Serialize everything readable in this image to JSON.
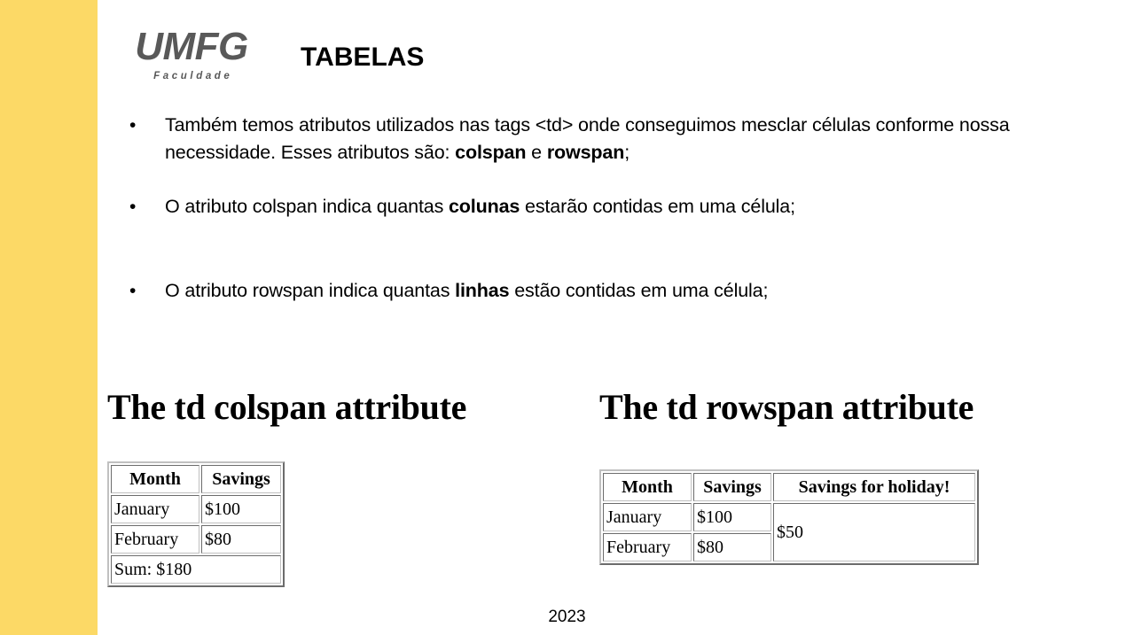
{
  "accent": {
    "color": "#fcd966"
  },
  "header": {
    "logo_word": "UMFG",
    "logo_sub": "Faculdade",
    "title": "TABELAS"
  },
  "bullets": [
    {
      "marker": "•",
      "parts": [
        {
          "text": "Também temos atributos utilizados nas tags <td> onde conseguimos mesclar células conforme nossa necessidade. Esses atributos são: ",
          "bold": false
        },
        {
          "text": "colspan",
          "bold": true
        },
        {
          "text": " e ",
          "bold": false
        },
        {
          "text": "rowspan",
          "bold": true
        },
        {
          "text": ";",
          "bold": false
        }
      ]
    },
    {
      "marker": "•",
      "parts": [
        {
          "text": "O atributo colspan indica quantas ",
          "bold": false
        },
        {
          "text": "colunas",
          "bold": true
        },
        {
          "text": " estarão contidas em uma célula;",
          "bold": false
        }
      ]
    },
    {
      "marker": "•",
      "parts": [
        {
          "text": "O atributo rowspan indica quantas ",
          "bold": false
        },
        {
          "text": "linhas",
          "bold": true
        },
        {
          "text": " estão contidas em uma célula;",
          "bold": false
        }
      ]
    }
  ],
  "examples": {
    "colspan": {
      "heading": "The td colspan attribute",
      "table": {
        "headers": [
          "Month",
          "Savings"
        ],
        "rows": [
          [
            "January",
            "$100"
          ],
          [
            "February",
            "$80"
          ]
        ],
        "footer_cell": {
          "text": "Sum: $180",
          "colspan": 2
        }
      }
    },
    "rowspan": {
      "heading": "The td rowspan attribute",
      "table": {
        "headers": [
          "Month",
          "Savings",
          "Savings for holiday!"
        ],
        "rows": [
          [
            "January",
            "$100"
          ],
          [
            "February",
            "$80"
          ]
        ],
        "rowspan_cell": {
          "text": "$50",
          "rowspan": 2
        }
      }
    }
  },
  "footer": {
    "year": "2023"
  }
}
